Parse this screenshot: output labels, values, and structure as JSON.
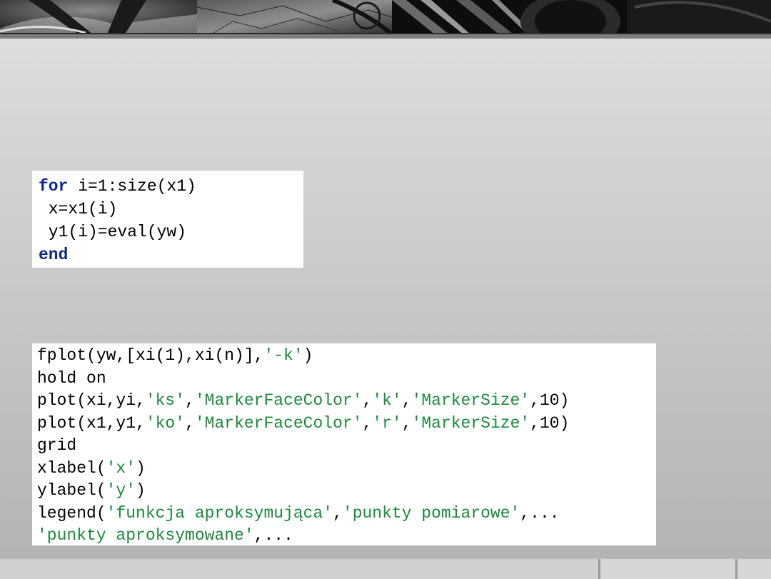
{
  "header": {
    "image_panels": [
      "wheel-rim-image",
      "cracked-disc-image",
      "tire-tread-image"
    ]
  },
  "code_blocks": [
    {
      "lines": [
        [
          {
            "t": "for",
            "c": "kw"
          },
          {
            "t": " i=1:size(x1)"
          }
        ],
        [
          {
            "t": " x=x1(i)"
          }
        ],
        [
          {
            "t": " y1(i)=eval(yw)"
          }
        ],
        [
          {
            "t": "end",
            "c": "kw"
          }
        ]
      ]
    },
    {
      "lines": [
        [
          {
            "t": "fplot(yw,[xi(1),xi(n)],"
          },
          {
            "t": "'-k'",
            "c": "str"
          },
          {
            "t": ")"
          }
        ],
        [
          {
            "t": "hold on"
          }
        ],
        [
          {
            "t": "plot(xi,yi,"
          },
          {
            "t": "'ks'",
            "c": "str"
          },
          {
            "t": ","
          },
          {
            "t": "'MarkerFaceColor'",
            "c": "str"
          },
          {
            "t": ","
          },
          {
            "t": "'k'",
            "c": "str"
          },
          {
            "t": ","
          },
          {
            "t": "'MarkerSize'",
            "c": "str"
          },
          {
            "t": ",10)"
          }
        ],
        [
          {
            "t": "plot(x1,y1,"
          },
          {
            "t": "'ko'",
            "c": "str"
          },
          {
            "t": ","
          },
          {
            "t": "'MarkerFaceColor'",
            "c": "str"
          },
          {
            "t": ","
          },
          {
            "t": "'r'",
            "c": "str"
          },
          {
            "t": ","
          },
          {
            "t": "'MarkerSize'",
            "c": "str"
          },
          {
            "t": ",10)"
          }
        ],
        [
          {
            "t": "grid"
          }
        ],
        [
          {
            "t": "xlabel("
          },
          {
            "t": "'x'",
            "c": "str"
          },
          {
            "t": ")"
          }
        ],
        [
          {
            "t": "ylabel("
          },
          {
            "t": "'y'",
            "c": "str"
          },
          {
            "t": ")"
          }
        ],
        [
          {
            "t": "legend("
          },
          {
            "t": "'funkcja aproksymująca'",
            "c": "str"
          },
          {
            "t": ","
          },
          {
            "t": "'punkty pomiarowe'",
            "c": "str"
          },
          {
            "t": ",..."
          }
        ],
        [
          {
            "t": "'punkty aproksymowane'",
            "c": "str"
          },
          {
            "t": ",..."
          }
        ]
      ]
    }
  ],
  "colors": {
    "keyword": "#0e2a8a",
    "string": "#1a8a3a",
    "background": "#d0d0d0"
  }
}
